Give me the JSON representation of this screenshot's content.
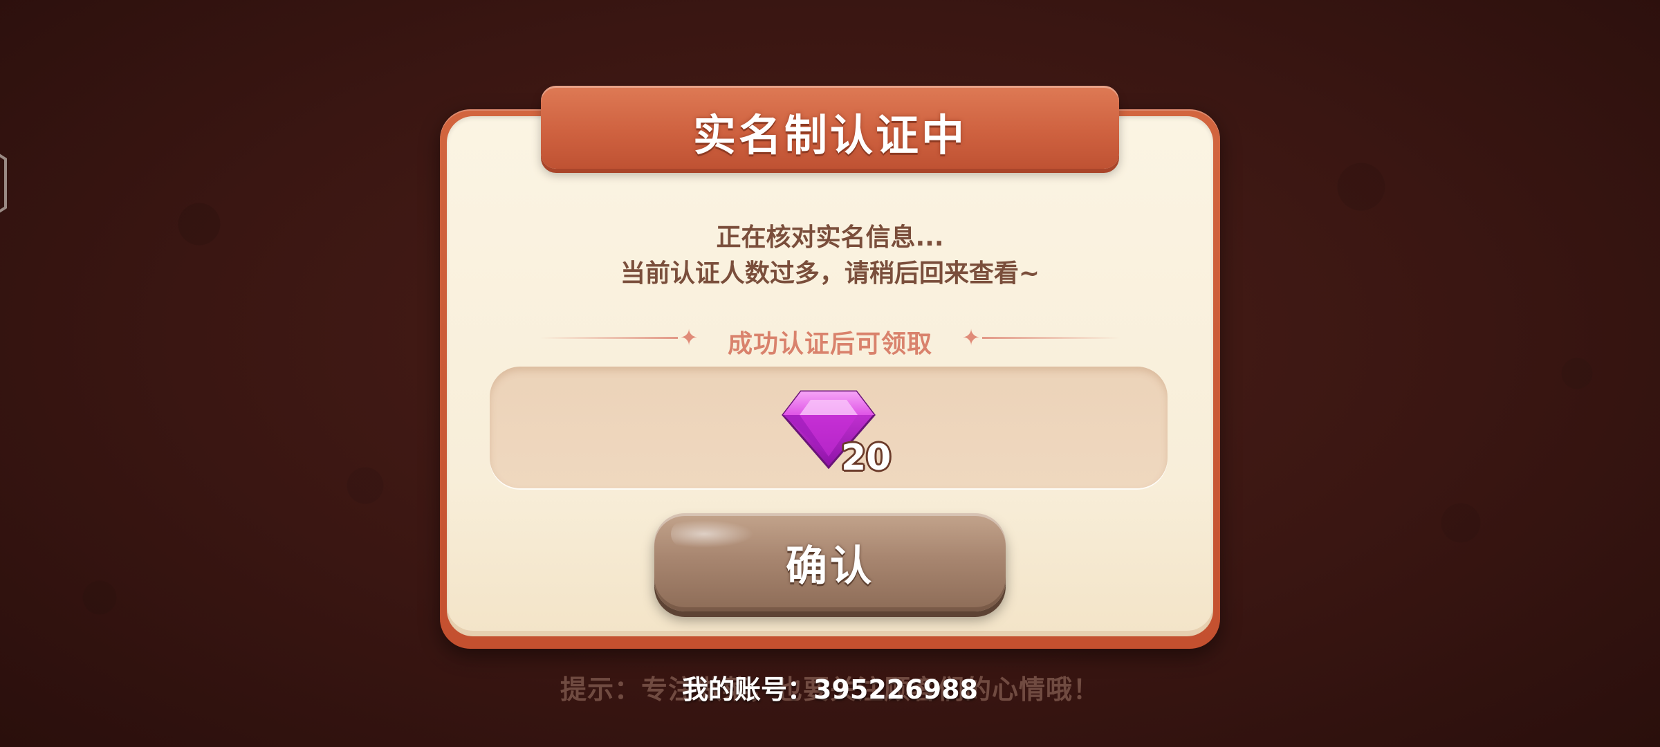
{
  "dialog": {
    "title": "实名制认证中",
    "message_line1": "正在核对实名信息...",
    "message_line2": "当前认证人数过多，请稍后回来查看~",
    "reward_header": "成功认证后可领取",
    "reward": {
      "icon": "gem-icon",
      "count": "20"
    },
    "confirm_label": "确认"
  },
  "footer": {
    "tip": "提示：专注做菜，也要关注顾客们的心情哦！",
    "account": "我的账号：395226988"
  },
  "colors": {
    "frame": "#c4502f",
    "panel": "#fbf4e3",
    "text_brown": "#7a4e3b",
    "accent_pink": "#d9826c",
    "gem": "#d63ee0",
    "button": "#a88670"
  }
}
